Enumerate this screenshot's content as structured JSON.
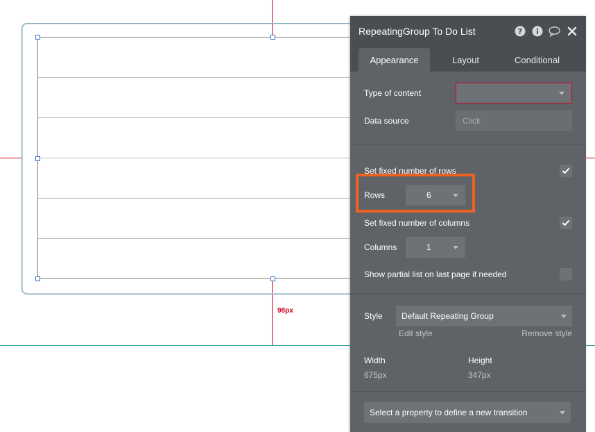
{
  "canvas": {
    "distance_label": "98px",
    "row_count": 6
  },
  "panel": {
    "title": "RepeatingGroup To Do List",
    "header_icons": [
      "help-icon",
      "info-icon",
      "comment-icon",
      "close-icon"
    ],
    "tabs": [
      {
        "label": "Appearance",
        "active": true
      },
      {
        "label": "Layout",
        "active": false
      },
      {
        "label": "Conditional",
        "active": false
      }
    ],
    "type_of_content": {
      "label": "Type of content",
      "value": ""
    },
    "data_source": {
      "label": "Data source",
      "placeholder": "Click"
    },
    "fixed_rows": {
      "label": "Set fixed number of rows",
      "checked": true
    },
    "rows": {
      "label": "Rows",
      "value": "6"
    },
    "fixed_columns": {
      "label": "Set fixed number of columns",
      "checked": true
    },
    "columns": {
      "label": "Columns",
      "value": "1"
    },
    "partial_list": {
      "label": "Show partial list on last page if needed",
      "checked": false
    },
    "style": {
      "label": "Style",
      "value": "Default Repeating Group",
      "edit_label": "Edit style",
      "remove_label": "Remove style"
    },
    "width": {
      "label": "Width",
      "value": "675px"
    },
    "height": {
      "label": "Height",
      "value": "347px"
    },
    "transition": {
      "placeholder": "Select a property to define a new transition"
    }
  },
  "colors": {
    "highlight": "#ee6320",
    "guide_red": "#d0021b",
    "guide_teal": "#2aa198",
    "panel_bg": "#5f6266",
    "handle": "#2f6fc9"
  }
}
